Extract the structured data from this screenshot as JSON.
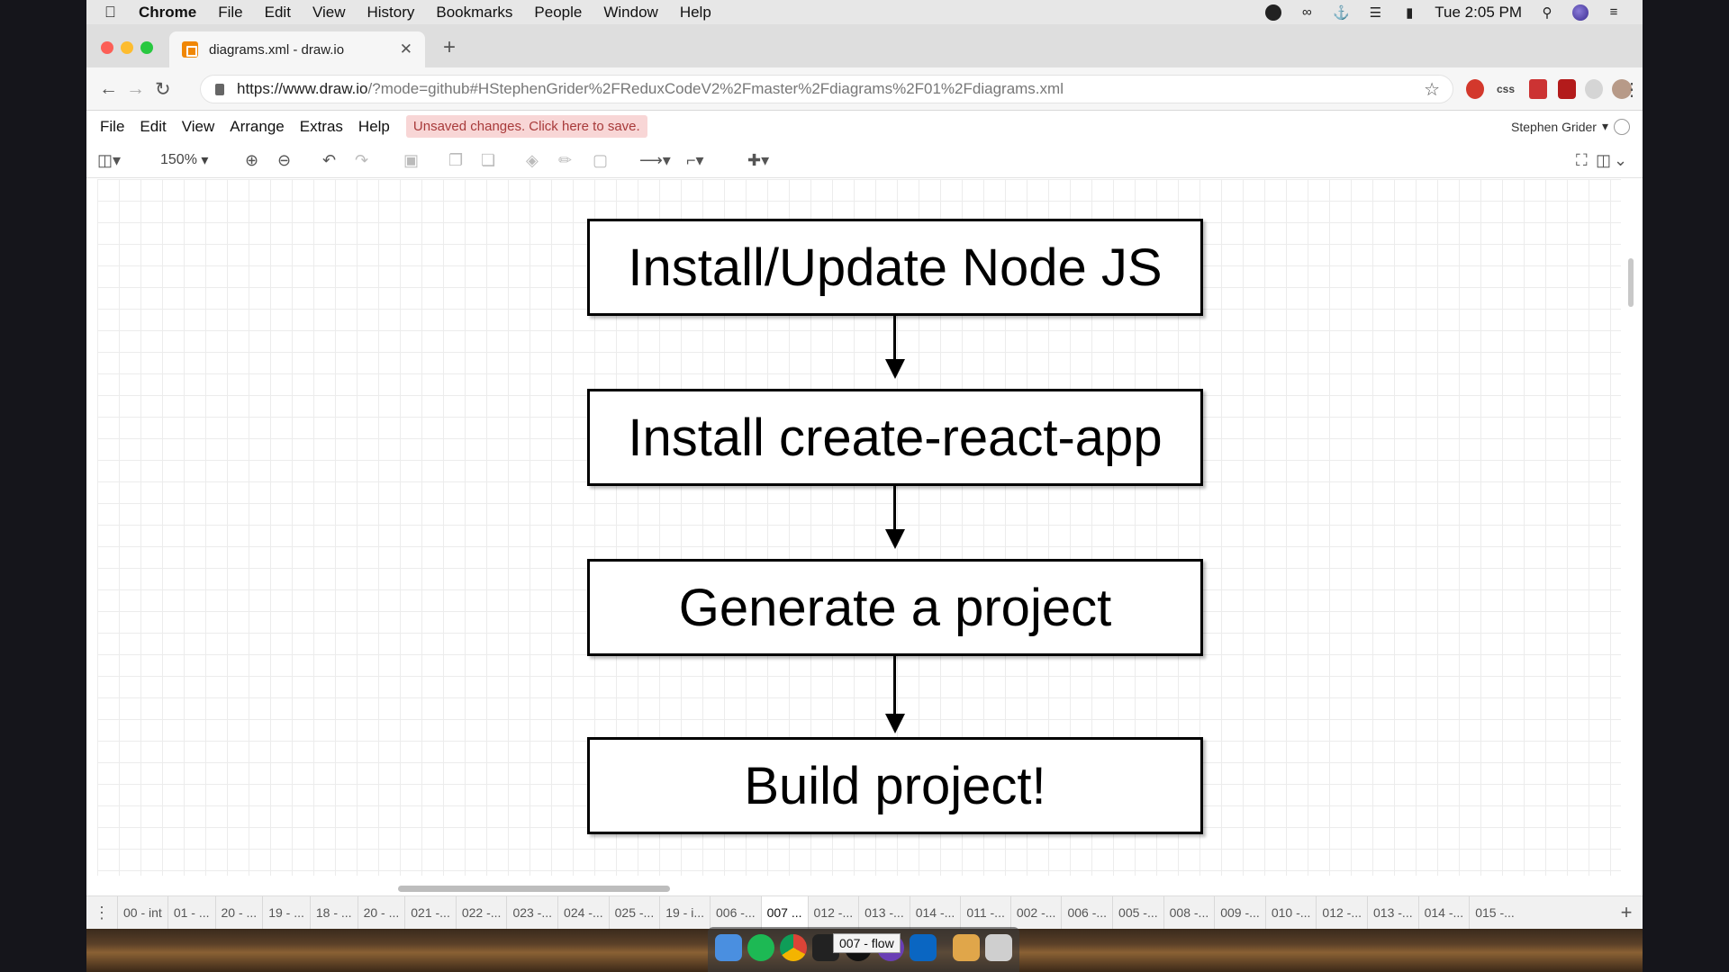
{
  "menubar": {
    "app_name": "Chrome",
    "items": [
      "File",
      "Edit",
      "View",
      "History",
      "Bookmarks",
      "People",
      "Window",
      "Help"
    ],
    "clock": "Tue 2:05 PM"
  },
  "browser": {
    "tab_title": "diagrams.xml - draw.io",
    "url_host": "https://www.draw.io",
    "url_path": "/?mode=github#HStephenGrider%2FReduxCodeV2%2Fmaster%2Fdiagrams%2F01%2Fdiagrams.xml",
    "ext_css_label": "css"
  },
  "app_menu": {
    "items": [
      "File",
      "Edit",
      "View",
      "Arrange",
      "Extras",
      "Help"
    ],
    "unsaved_notice": "Unsaved changes. Click here to save.",
    "user_name": "Stephen Grider"
  },
  "toolbar": {
    "zoom_level": "150%"
  },
  "diagram": {
    "nodes": [
      "Install/Update Node JS",
      "Install create-react-app",
      "Generate a project",
      "Build project!"
    ]
  },
  "page_tabs": {
    "tabs": [
      "00 - int",
      "01 - ...",
      "20 - ...",
      "19 - ...",
      "18 - ...",
      "20 - ...",
      "021 -...",
      "022 -...",
      "023 -...",
      "024 -...",
      "025 -...",
      "19 - i...",
      "006 -...",
      "007 ...",
      "012 -...",
      "013 -...",
      "014 -...",
      "011 -...",
      "002 -...",
      "006 -...",
      "005 -...",
      "008 -...",
      "009 -...",
      "010 -...",
      "012 -...",
      "013 -...",
      "014 -...",
      "015 -..."
    ],
    "active_index": 13,
    "tooltip": "007 - flow"
  }
}
